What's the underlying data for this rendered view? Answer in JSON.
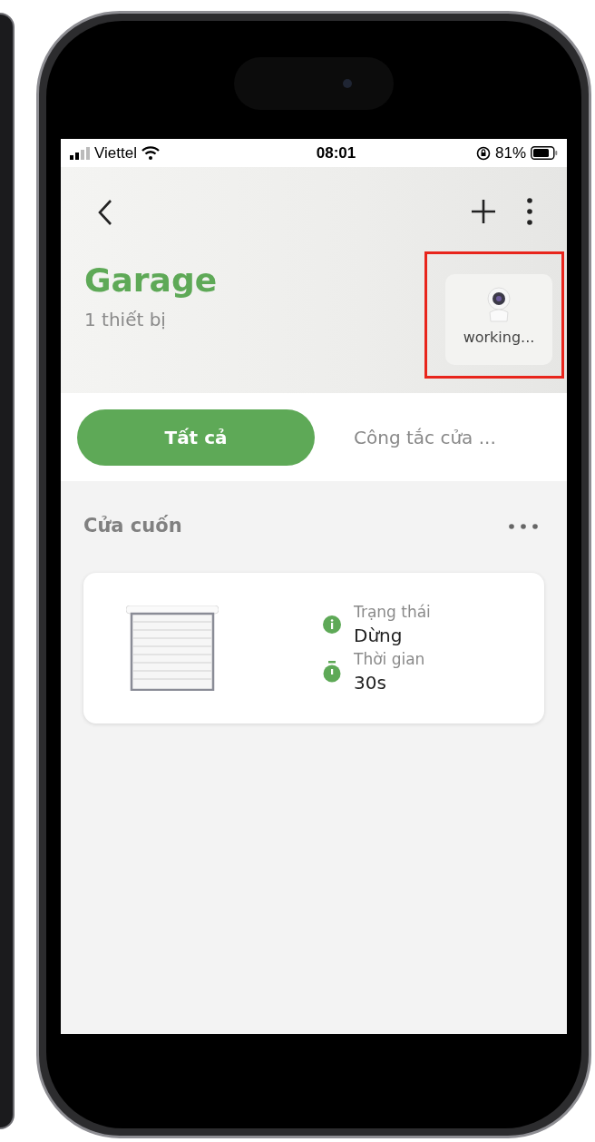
{
  "status_bar": {
    "carrier": "Viettel",
    "time": "08:01",
    "battery": "81%"
  },
  "header": {
    "title": "Garage",
    "subtitle": "1 thiết bị",
    "camera_widget": {
      "label": "working..."
    }
  },
  "tabs": [
    {
      "label": "Tất cả",
      "selected": true
    },
    {
      "label": "Công tắc cửa ...",
      "selected": false
    }
  ],
  "section": {
    "title": "Cửa cuốn"
  },
  "device": {
    "fields": [
      {
        "kind": "info",
        "label": "Trạng thái",
        "value": "Dừng"
      },
      {
        "kind": "timer",
        "label": "Thời gian",
        "value": "30s"
      }
    ]
  }
}
